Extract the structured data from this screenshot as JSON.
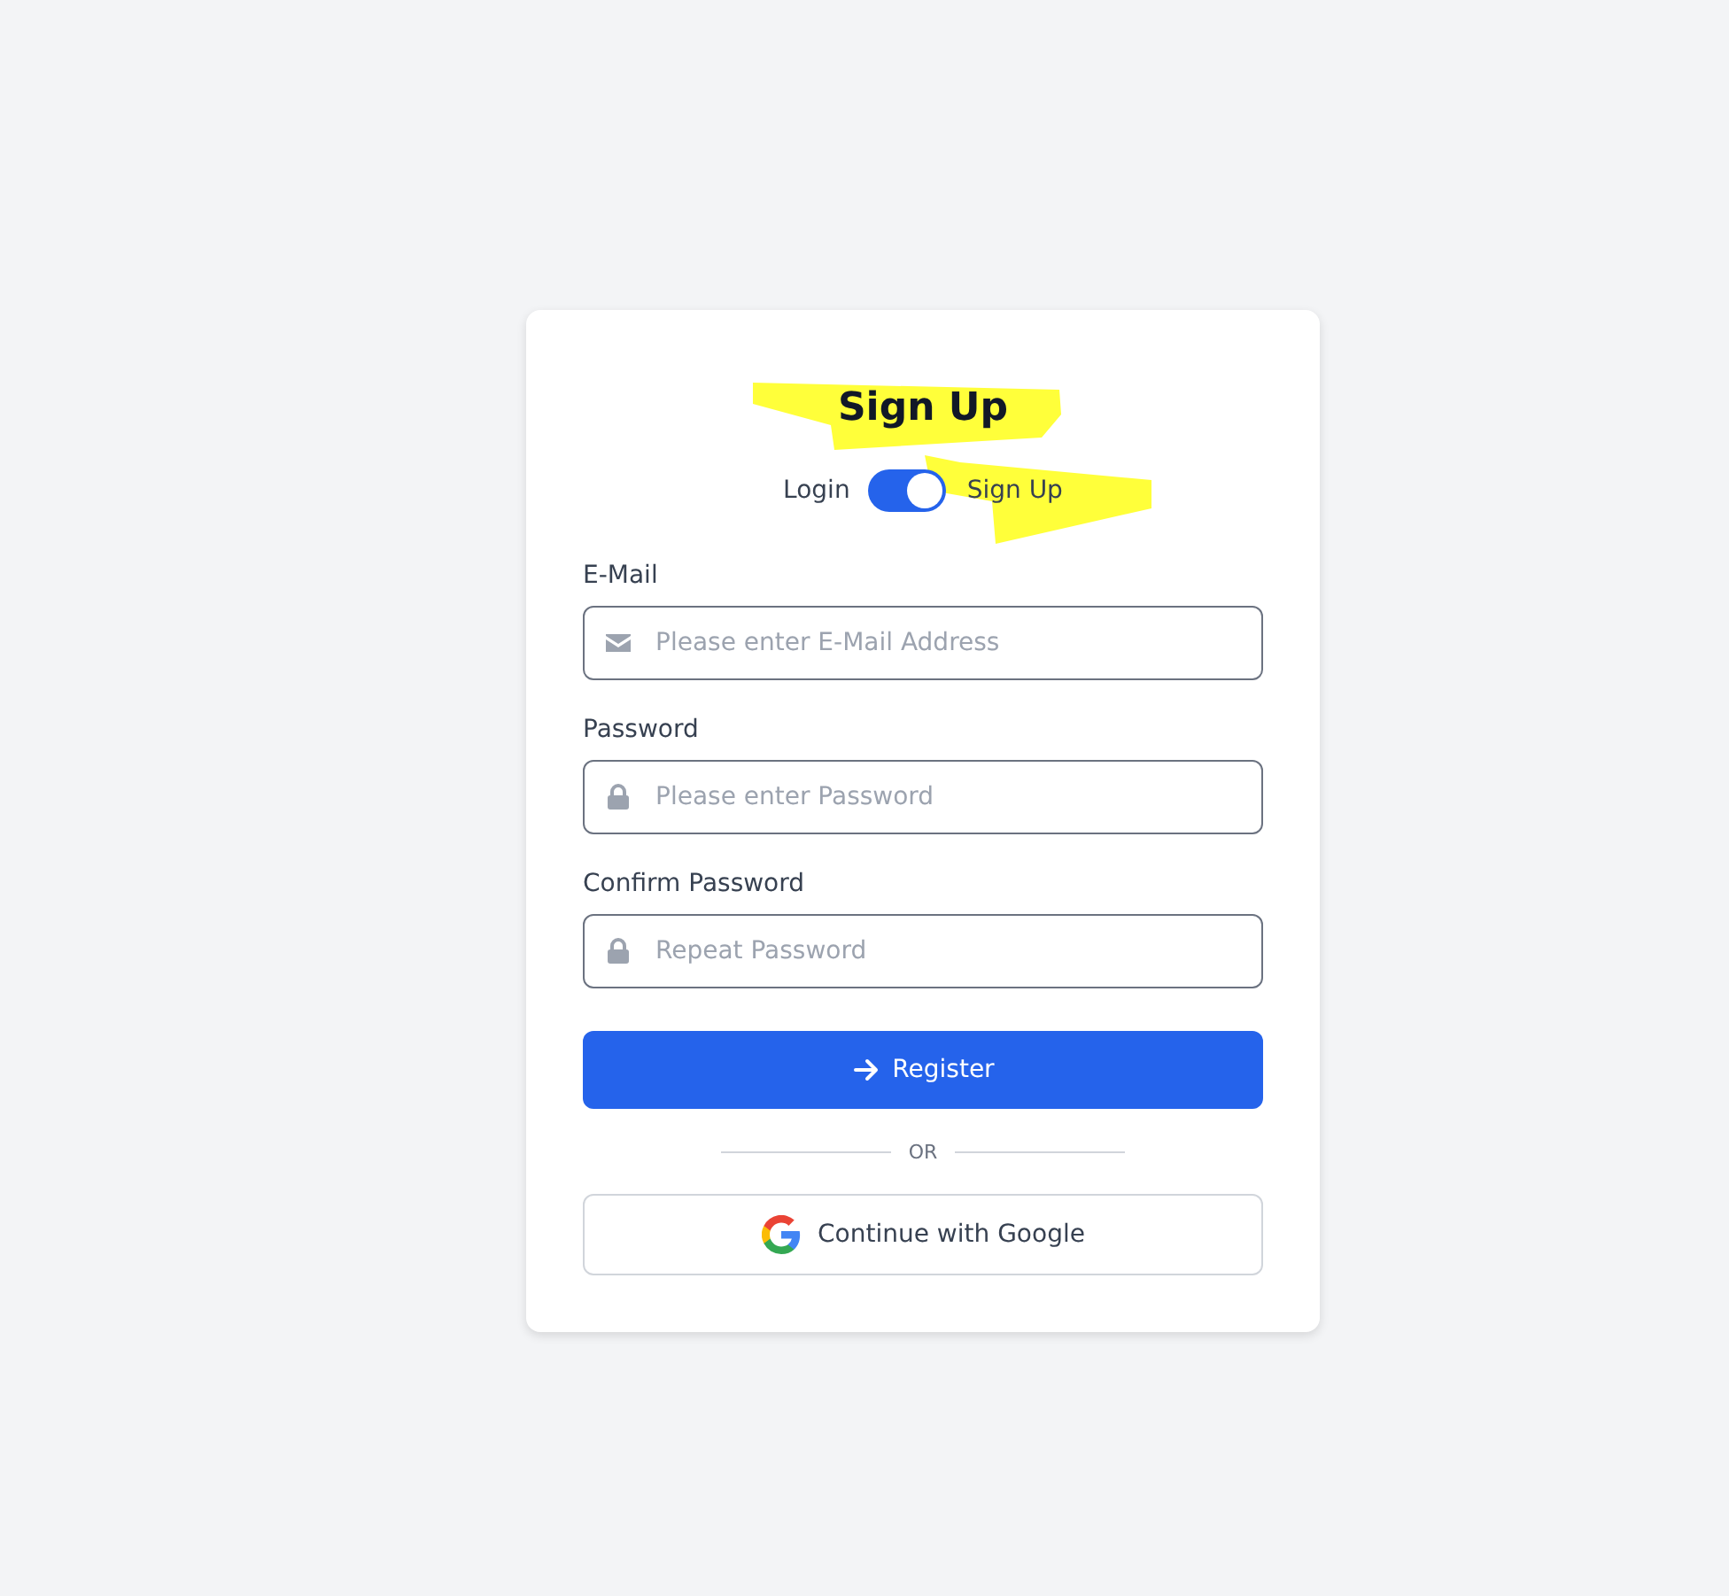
{
  "title": {
    "text": "Sign Up",
    "highlighted": true
  },
  "mode_toggle": {
    "left_label": "Login",
    "right_label": "Sign Up",
    "on": true,
    "right_highlighted": true
  },
  "fields": [
    {
      "kind": "email",
      "label": "E-Mail",
      "placeholder": "Please enter E-Mail Address"
    },
    {
      "kind": "password",
      "label": "Password",
      "placeholder": "Please enter Password"
    },
    {
      "kind": "password",
      "label": "Confirm Password",
      "placeholder": "Repeat Password"
    }
  ],
  "submit_button": "Register",
  "divider": "OR",
  "google_button": "Continue with Google"
}
